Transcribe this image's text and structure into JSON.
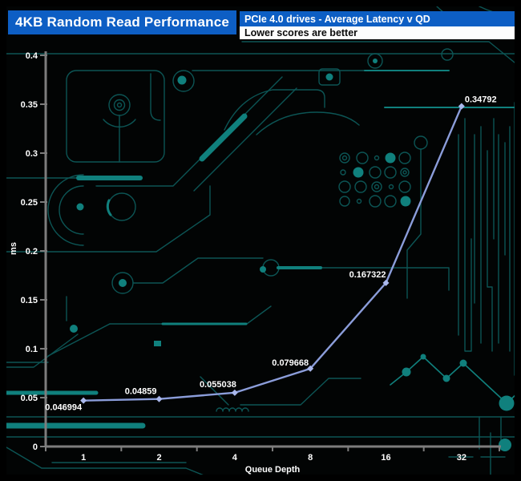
{
  "header": {
    "title": "4KB Random Read Performance",
    "subtitle": "PCIe 4.0 drives - Average Latency v QD",
    "note": "Lower scores are better"
  },
  "chart_data": {
    "type": "line",
    "title": "4KB Random Read Performance",
    "subtitle": "PCIe 4.0 drives - Average Latency v QD",
    "note": "Lower scores are better",
    "xlabel": "Queue Depth",
    "ylabel": "ms",
    "categories": [
      "1",
      "2",
      "4",
      "8",
      "16",
      "32"
    ],
    "values": [
      0.046994,
      0.04859,
      0.055038,
      0.079668,
      0.167322,
      0.34792
    ],
    "point_labels": [
      "0.046994",
      "0.04859",
      "0.055038",
      "0.079668",
      "0.167322",
      "0.34792"
    ],
    "yticks": [
      "0",
      "0.05",
      "0.1",
      "0.15",
      "0.2",
      "0.25",
      "0.3",
      "0.35",
      "0.4"
    ],
    "ylim": [
      0,
      0.4
    ],
    "grid": false,
    "legend": "none",
    "colors": {
      "line": "#8b9dda",
      "marker": "#aab8ec",
      "axis": "#7d7d7d",
      "text": "#ffffff",
      "header_blue": "#0d5ec4",
      "circuit_dim": "#0c5555",
      "circuit_bright": "#10807d"
    }
  }
}
